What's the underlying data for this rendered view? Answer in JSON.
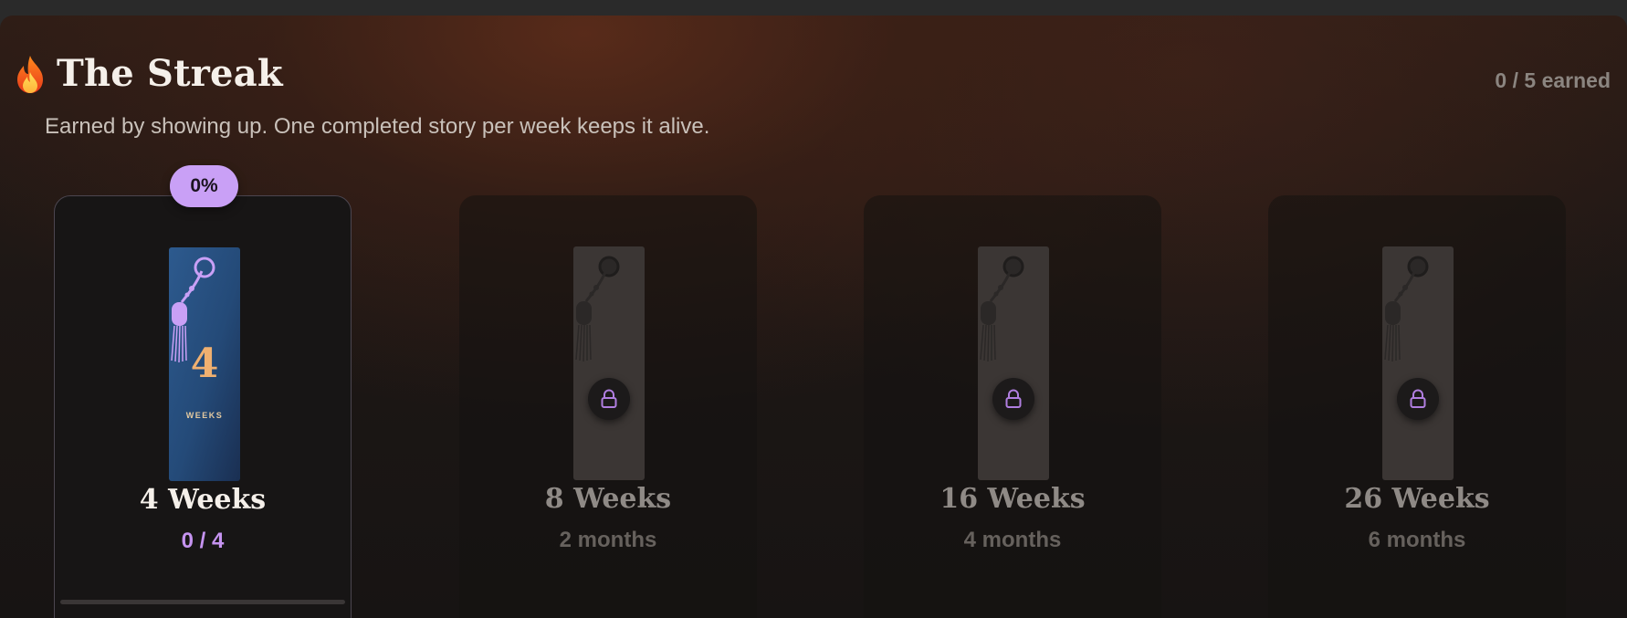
{
  "header": {
    "title": "The Streak",
    "earned": "0 / 5 earned",
    "subtitle": "Earned by showing up. One completed story per week keeps it alive.",
    "icon": "fire-icon"
  },
  "cards": [
    {
      "badge_num": "4",
      "badge_unit": "WEEKS",
      "title": "4 Weeks",
      "sub": "0 / 4",
      "progress_label": "0%",
      "progress": 0,
      "locked": false
    },
    {
      "title": "8 Weeks",
      "sub": "2 months",
      "locked": true
    },
    {
      "title": "16 Weeks",
      "sub": "4 months",
      "locked": true
    },
    {
      "title": "26 Weeks",
      "sub": "6 months",
      "locked": true
    }
  ],
  "colors": {
    "accent": "#c593f0",
    "badge": "#c9a0f6",
    "gold": "#f0b070",
    "bookmark_blue": "#244a78"
  }
}
